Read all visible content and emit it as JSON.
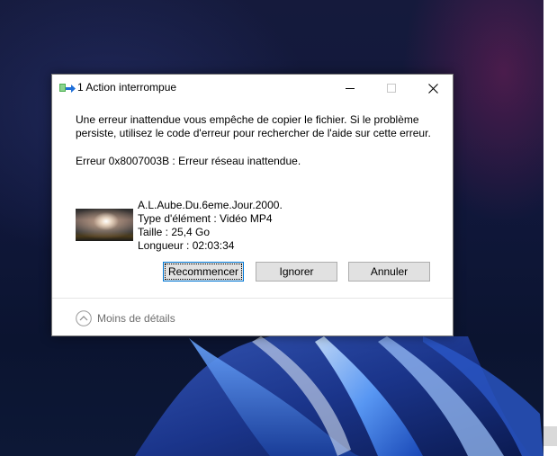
{
  "dialog": {
    "title": "1 Action interrompue",
    "message": "Une erreur inattendue vous empêche de copier le fichier. Si le problème persiste, utilisez le code d'erreur pour rechercher de l'aide sur cette erreur.",
    "error": "Erreur 0x8007003B : Erreur réseau inattendue.",
    "file": {
      "name": "A.L.Aube.Du.6eme.Jour.2000.",
      "type": "Type d'élément : Vidéo MP4",
      "size": "Taille : 25,4 Go",
      "length": "Longueur : 02:03:34"
    },
    "buttons": {
      "retry": "Recommencer",
      "ignore": "Ignorer",
      "cancel": "Annuler"
    },
    "details_toggle": "Moins de détails"
  },
  "colors": {
    "accent": "#0078d7",
    "button_bg": "#e1e1e1",
    "button_border": "#adadad",
    "muted_text": "#6d6d6d"
  },
  "icons": {
    "title": "file-copy-icon",
    "minimize": "minimize-icon",
    "maximize": "maximize-icon",
    "close": "close-icon",
    "details": "chevron-up-circle-icon"
  }
}
